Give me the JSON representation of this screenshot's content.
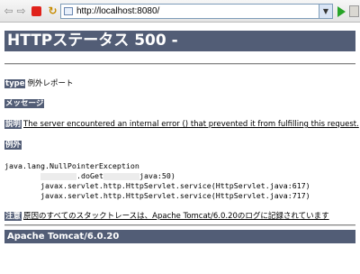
{
  "browser": {
    "url": "http://localhost:8080/"
  },
  "page": {
    "title": "HTTPステータス 500 -",
    "type_label": "type",
    "type_value": "例外レポート",
    "message_label": "メッセージ",
    "description_label": "説明",
    "description_text": "The server encountered an internal error () that prevented it from fulfilling this request.",
    "exception_label": "例外",
    "trace": {
      "line1": "java.lang.NullPointerException",
      "line2_suffix": ".doGet",
      "line2_tail": "java:50)",
      "line3": "javax.servlet.http.HttpServlet.service(HttpServlet.java:617)",
      "line4": "javax.servlet.http.HttpServlet.service(HttpServlet.java:717)"
    },
    "note_label": "注意",
    "note_text": "原因のすべてのスタックトレースは、Apache Tomcat/6.0.20のログに記録されています",
    "footer": "Apache Tomcat/6.0.20"
  }
}
